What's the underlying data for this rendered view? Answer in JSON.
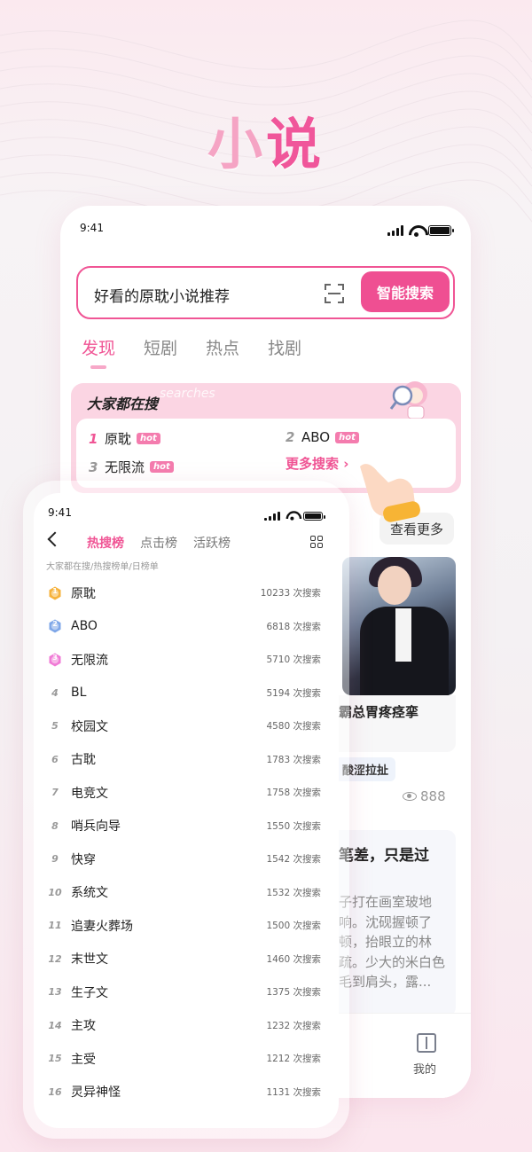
{
  "hero": {
    "title_a": "小",
    "title_b": "说"
  },
  "back_phone": {
    "status": {
      "time": "9:41"
    },
    "search": {
      "query": "好看的原耽小说推荐",
      "button": "智能搜索"
    },
    "tabs": [
      "发现",
      "短剧",
      "热点",
      "找剧"
    ],
    "hot": {
      "title": "大家都在搜",
      "ghost": "searches",
      "items": [
        {
          "rank": "1",
          "label": "原耽",
          "tag": "hot"
        },
        {
          "rank": "2",
          "label": "ABO",
          "tag": "hot"
        },
        {
          "rank": "3",
          "label": "无限流",
          "tag": "hot"
        }
      ],
      "more": "更多搜索 ›"
    },
    "see_more": "查看更多",
    "book": {
      "title": "霸总胃疼痉挛",
      "tag": "酸涩拉扯",
      "views": "888"
    },
    "story": {
      "title": "笔差，只是过",
      "excerpt": "子打在画室玻地响。沈砚握顿了顿，抬眼立的林疏。少大的米白色毛到肩头，露..."
    },
    "bottom_nav": {
      "mine": "我的"
    }
  },
  "front_phone": {
    "status": {
      "time": "9:41"
    },
    "tabs": [
      "热搜榜",
      "点击榜",
      "活跃榜"
    ],
    "subtitle": "大家都在搜/热搜榜单/日榜单",
    "colors": {
      "gold": "#f6b23b",
      "silver": "#7fa7e8",
      "bronze": "#f07ad6"
    },
    "ranks": [
      {
        "rank": "1",
        "name": "原耽",
        "count": "10233 次搜索"
      },
      {
        "rank": "2",
        "name": "ABO",
        "count": "6818 次搜索"
      },
      {
        "rank": "3",
        "name": "无限流",
        "count": "5710 次搜索"
      },
      {
        "rank": "4",
        "name": "BL",
        "count": "5194 次搜索"
      },
      {
        "rank": "5",
        "name": "校园文",
        "count": "4580 次搜索"
      },
      {
        "rank": "6",
        "name": "古耽",
        "count": "1783 次搜索"
      },
      {
        "rank": "7",
        "name": "电竞文",
        "count": "1758 次搜索"
      },
      {
        "rank": "8",
        "name": "哨兵向导",
        "count": "1550 次搜索"
      },
      {
        "rank": "9",
        "name": "快穿",
        "count": "1542 次搜索"
      },
      {
        "rank": "10",
        "name": "系统文",
        "count": "1532 次搜索"
      },
      {
        "rank": "11",
        "name": "追妻火葬场",
        "count": "1500 次搜索"
      },
      {
        "rank": "12",
        "name": "末世文",
        "count": "1460 次搜索"
      },
      {
        "rank": "13",
        "name": "生子文",
        "count": "1375 次搜索"
      },
      {
        "rank": "14",
        "name": "主攻",
        "count": "1232 次搜索"
      },
      {
        "rank": "15",
        "name": "主受",
        "count": "1212 次搜索"
      },
      {
        "rank": "16",
        "name": "灵异神怪",
        "count": "1131 次搜索"
      }
    ]
  }
}
